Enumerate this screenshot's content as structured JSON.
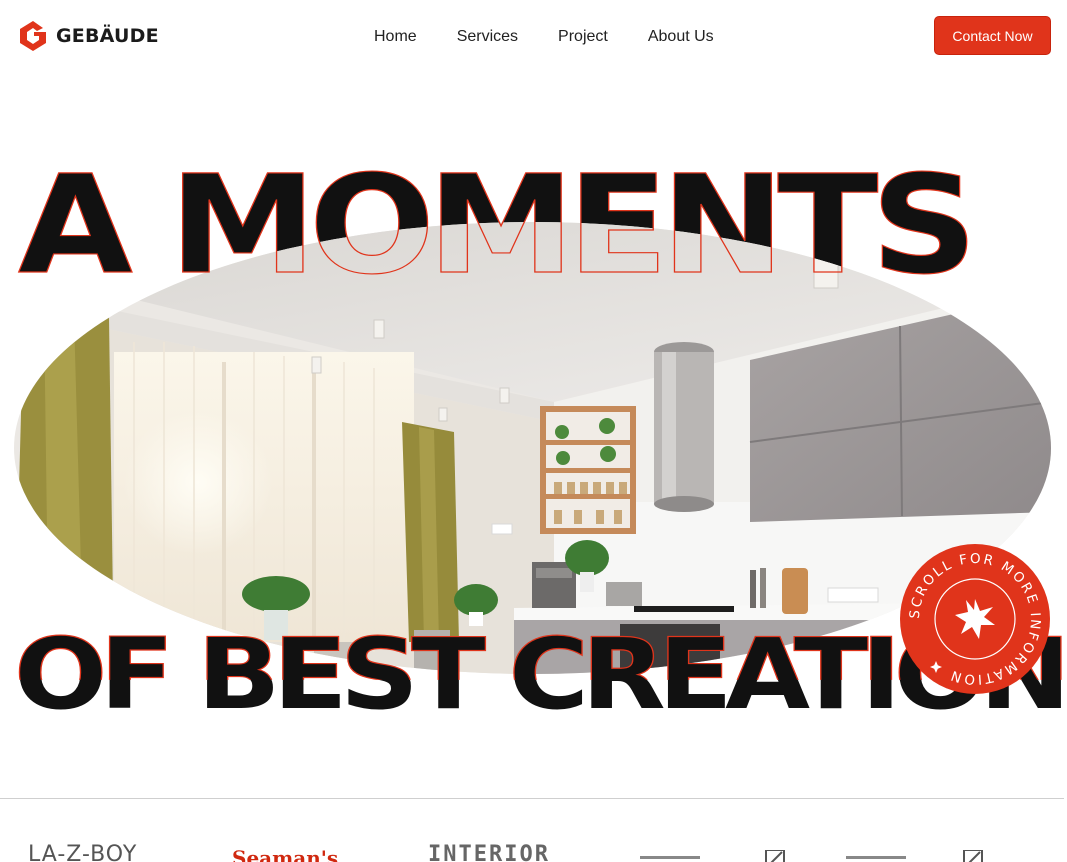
{
  "brand": {
    "name": "GEBÄUDE",
    "logo_icon": "gebaude-logo-icon",
    "accent": "#e0341b"
  },
  "nav": {
    "items": [
      "Home",
      "Services",
      "Project",
      "About Us"
    ]
  },
  "cta": {
    "label": "Contact Now"
  },
  "hero": {
    "line1": "A MOMENTS",
    "line2": "OF BEST CREATION",
    "image_alt": "kitchen-interior-photo"
  },
  "scroll_badge": {
    "text": "SCROLL FOR MORE INFORMATION",
    "icon": "starburst-icon"
  },
  "partners": [
    "LA-Z-BOY",
    "Seaman's",
    "INTERIOR",
    "partner-logo",
    "partner-logo"
  ],
  "colors": {
    "accent": "#e0341b",
    "text": "#111111",
    "background": "#ffffff"
  }
}
